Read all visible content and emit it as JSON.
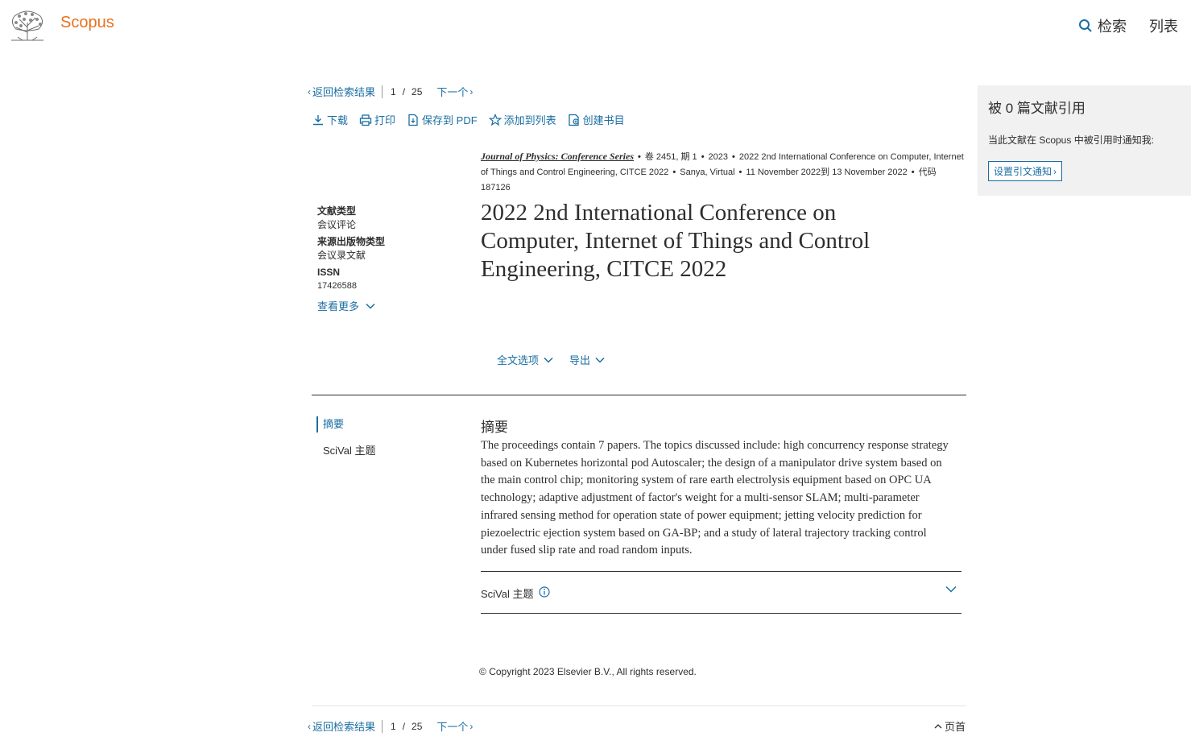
{
  "header": {
    "brand": "Scopus",
    "nav_search": "检索",
    "nav_lists": "列表",
    "brand_color": "#e9711c"
  },
  "pager": {
    "back": "返回检索结果",
    "current": "1",
    "separator": "/",
    "total": "25",
    "next": "下一个"
  },
  "toolbar": {
    "download": "下载",
    "print": "打印",
    "save_pdf": "保存到 PDF",
    "add_to_list": "添加到列表",
    "bibliography": "创建书目"
  },
  "source": {
    "journal": "Journal of Physics: Conference Series",
    "volume_issue": "卷 2451, 期 1",
    "year": "2023",
    "conference": "2022 2nd International Conference on Computer, Internet of Things and Control Engineering, CITCE 2022",
    "location": "Sanya, Virtual",
    "dates": "11 November 2022到 13 November 2022",
    "code": "代码 187126"
  },
  "meta": {
    "doc_type_label": "文献类型",
    "doc_type_value": "会议评论",
    "source_type_label": "来源出版物类型",
    "source_type_value": "会议录文献",
    "issn_label": "ISSN",
    "issn_value": "17426588",
    "view_more": "查看更多"
  },
  "title": "2022 2nd International Conference on Computer, Internet of Things and Control Engineering, CITCE 2022",
  "options": {
    "full_text": "全文选项",
    "export": "导出"
  },
  "sidenav": {
    "abstract": "摘要",
    "scival": "SciVal 主题"
  },
  "abstract": {
    "heading": "摘要",
    "text": "The proceedings contain 7 papers. The topics discussed include: high concurrency response strategy based on Kubernetes horizontal pod Autoscaler; the design of a manipulator drive system based on the main control chip; monitoring system of rare earth electrolysis equipment based on OPC UA technology; adaptive adjustment of factor's weight for a multi-sensor SLAM; multi-parameter infrared sensing method for operation state of power equipment; jetting velocity prediction for piezoelectric ejection system based on GA-BP; and a study of lateral trajectory tracking control under fused slip rate and road random inputs."
  },
  "scival": {
    "label": "SciVal 主题"
  },
  "copyright": "Copyright 2023 Elsevier B.V., All rights reserved.",
  "footer": {
    "top": "页首"
  },
  "citations": {
    "heading": "被 0 篇文献引用",
    "notify_text": "当此文献在 Scopus 中被引用时通知我:",
    "button": "设置引文通知"
  },
  "colors": {
    "link": "#1a6ea3",
    "panel_bg": "#f1f1f1"
  }
}
